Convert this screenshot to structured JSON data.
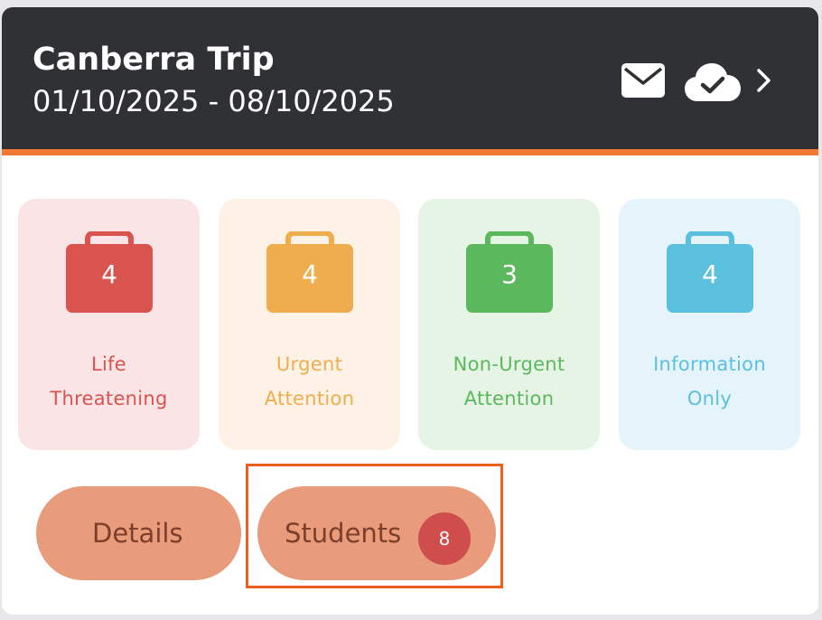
{
  "trip": {
    "title": "Canberra Trip",
    "dates": "01/10/2025 - 08/10/2025"
  },
  "header_icons": [
    "mail-icon",
    "cloud-check-icon",
    "chevron-right-icon"
  ],
  "categories": [
    {
      "count": "4",
      "label_line1": "Life",
      "label_line2": "Threatening",
      "color": "#d9534f",
      "bg": "#fae4e6"
    },
    {
      "count": "4",
      "label_line1": "Urgent",
      "label_line2": "Attention",
      "color": "#f0ad4e",
      "bg": "#fdf2e5"
    },
    {
      "count": "3",
      "label_line1": "Non-Urgent",
      "label_line2": "Attention",
      "color": "#5cb85c",
      "bg": "#e6f4e6"
    },
    {
      "count": "4",
      "label_line1": "Information",
      "label_line2": "Only",
      "color": "#5bc0de",
      "bg": "#e5f4fa"
    }
  ],
  "actions": {
    "details_label": "Details",
    "students_label": "Students",
    "students_count": "8"
  },
  "colors": {
    "header_bg": "#303135",
    "accent_orange": "#f07a34",
    "pill_bg": "#e89c7b",
    "pill_text": "#7d3e2a",
    "badge": "#cf4d4a",
    "highlight": "#ec5f1e"
  }
}
